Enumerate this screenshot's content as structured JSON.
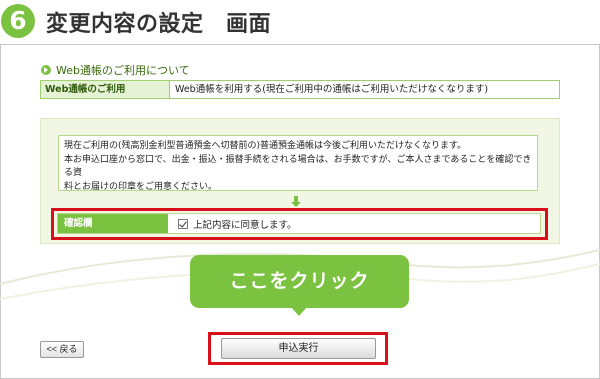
{
  "header": {
    "step_number": "6",
    "title": "変更内容の設定　画面"
  },
  "section": {
    "title": "Web通帳のご利用について"
  },
  "info_table": {
    "label": "Web通帳のご利用",
    "value": "Web通帳を利用する(現在ご利用中の通帳はご利用いただけなくなります)"
  },
  "notice": {
    "lines": [
      "現在ご利用の(残高別金利型普通預金へ切替前の)普通預金通帳は今後ご利用いただけなくなります。",
      "本お申込口座から窓口で、出金・振込・振替手続をされる場合は、お手数ですが、ご本人さまであることを確認できる資",
      "料とお届けの印章をご用意ください。"
    ]
  },
  "confirm": {
    "label": "確認欄",
    "checkbox_label": "上記内容に同意します。",
    "checked": true
  },
  "callout": {
    "text": "ここをクリック"
  },
  "buttons": {
    "back": "<< 戻る",
    "submit": "申込実行"
  },
  "colors": {
    "accent_green": "#7cc241",
    "highlight_red": "#d8101a"
  }
}
